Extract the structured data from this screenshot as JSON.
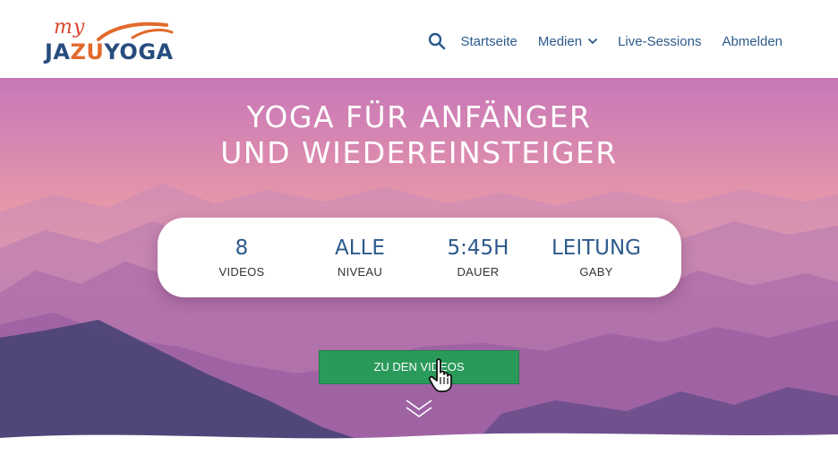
{
  "logo": {
    "my": "my",
    "ja": "JA",
    "zu": "ZU",
    "yoga": "YOGA"
  },
  "nav": {
    "search_icon": "search-icon",
    "items": [
      {
        "label": "Startseite"
      },
      {
        "label": "Medien",
        "icon": "chevron-down-icon"
      },
      {
        "label": "Live-Sessions"
      },
      {
        "label": "Abmelden"
      }
    ]
  },
  "hero": {
    "title_line1": "YOGA FÜR ANFÄNGER",
    "title_line2": "UND WIEDEREINSTEIGER"
  },
  "stats": [
    {
      "value": "8",
      "label": "VIDEOS"
    },
    {
      "value": "ALLE",
      "label": "NIVEAU"
    },
    {
      "value": "5:45H",
      "label": "DAUER"
    },
    {
      "value": "LEITUNG",
      "label": "GABY"
    }
  ],
  "cta": {
    "label": "ZU DEN VIDEOS"
  },
  "colors": {
    "nav_text": "#2c5a8c",
    "cta_bg": "#2a9a5b",
    "logo_orange": "#e26a2c",
    "logo_blue": "#274d7e"
  }
}
